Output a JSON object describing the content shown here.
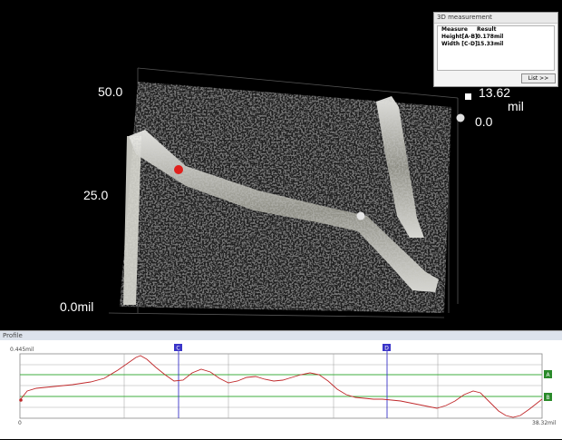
{
  "viewport": {
    "z_axis_labels": {
      "top": "50.0",
      "middle": "25.0",
      "bottom": "0.0mil"
    },
    "height_scale": {
      "max_value": "13.62",
      "unit": "mil",
      "min_value": "0.0"
    },
    "marker_colors": {
      "a_point": "#e0201c",
      "b_point": "#e4e4e4"
    }
  },
  "measurement_panel": {
    "title": "3D measurement",
    "headers": [
      "Measure",
      "Result"
    ],
    "rows": [
      {
        "measure": "Height[A-B]",
        "result": "0.178mil"
      },
      {
        "measure": "Width [C-D]",
        "result": "15.33mil"
      }
    ],
    "list_button": "List >>"
  },
  "profile_panel": {
    "title": "Profile",
    "y_max_label": "0.445mil",
    "x_min_label": "0",
    "x_max_label": "38.32mil",
    "cursors": {
      "c": "C",
      "d": "D",
      "a": "A",
      "b": "B"
    },
    "colors": {
      "curve": "#c0282a",
      "ref_lines": "#3fae3f",
      "cursor_lines": "#3a34c8",
      "grid": "#aaaaaa"
    }
  }
}
